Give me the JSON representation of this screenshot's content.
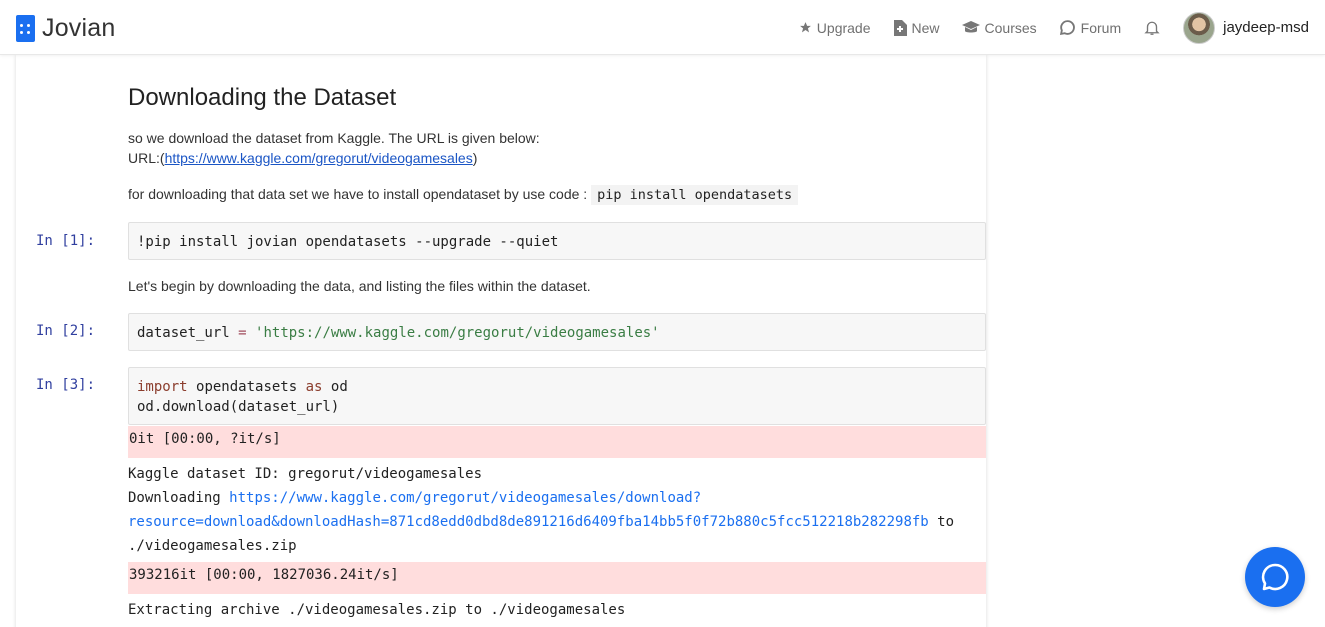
{
  "header": {
    "logo_text": "Jovian",
    "nav": {
      "upgrade": "Upgrade",
      "new": "New",
      "courses": "Courses",
      "forum": "Forum"
    },
    "username": "jaydeep-msd"
  },
  "notebook": {
    "heading": "Downloading the Dataset",
    "intro_line1": "so we download the dataset from Kaggle. The URL is given below:",
    "url_prefix": "URL:(",
    "url_link": "https://www.kaggle.com/gregorut/videogamesales",
    "url_suffix": ")",
    "install_text": "for downloading that data set we have to install opendataset by use code :",
    "install_code": "pip install opendatasets",
    "cell1": {
      "prompt": "In [1]:",
      "code": "!pip install jovian opendatasets --upgrade --quiet"
    },
    "md2": "Let's begin by downloading the data, and listing the files within the dataset.",
    "cell2": {
      "prompt": "In [2]:",
      "var": "dataset_url",
      "op": "=",
      "string": "'https://www.kaggle.com/gregorut/videogamesales'"
    },
    "cell3": {
      "prompt": "In [3]:",
      "kw_import": "import",
      "module": "opendatasets",
      "kw_as": "as",
      "alias": "od",
      "line2": "od.download(dataset_url)",
      "stderr1": "0it [00:00, ?it/s]",
      "out_line1": "Kaggle dataset ID:  gregorut/videogamesales",
      "out_downloading": "Downloading",
      "out_link_part1": "https://www.kaggle.com/gregorut/videogamesales/download?",
      "out_link_part2": "resource=download&downloadHash=871cd8edd0dbd8de891216d6409fba14bb5f0f72b880c5fcc512218b282298fb",
      "out_to": "to",
      "out_file": "./videogamesales.zip",
      "stderr2": "393216it [00:00, 1827036.24it/s]",
      "out_extract": "Extracting archive ./videogamesales.zip to ./videogamesales"
    }
  },
  "colors": {
    "accent": "#1a6ff0",
    "stderr_bg": "#ffdddd",
    "prompt": "#303f9f"
  }
}
